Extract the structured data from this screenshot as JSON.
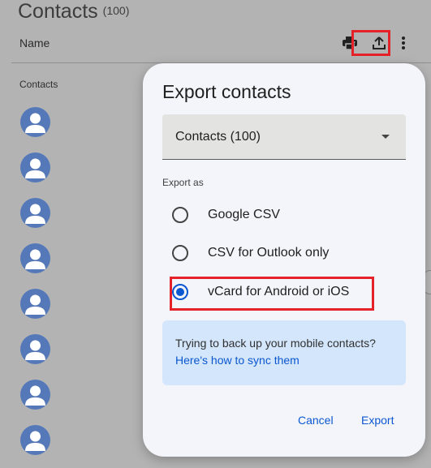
{
  "header": {
    "title": "Contacts",
    "count": "(100)",
    "name_column": "Name",
    "icons": [
      "print-icon",
      "export-icon",
      "more-vert-icon"
    ]
  },
  "list": {
    "section_label": "Contacts",
    "avatar_count": 8
  },
  "dialog": {
    "title": "Export contacts",
    "select_value": "Contacts (100)",
    "export_as_label": "Export as",
    "options": [
      {
        "label": "Google CSV",
        "selected": false
      },
      {
        "label": "CSV for Outlook only",
        "selected": false
      },
      {
        "label": "vCard for Android or iOS",
        "selected": true
      }
    ],
    "info_text": "Trying to back up your mobile contacts?",
    "info_link": "Here's how to sync them",
    "cancel_label": "Cancel",
    "export_label": "Export"
  },
  "colors": {
    "accent": "#0b57d0",
    "highlight": "#e5212a",
    "avatar": "#5579b8",
    "info_bg": "#d3e6fb"
  }
}
